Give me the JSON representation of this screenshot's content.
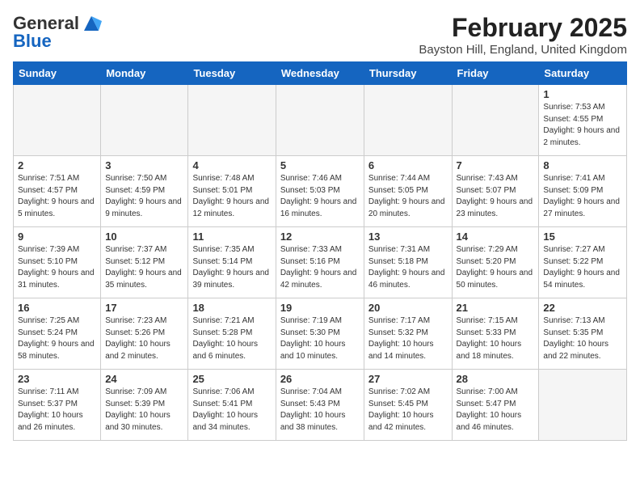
{
  "header": {
    "logo_text_general": "General",
    "logo_text_blue": "Blue",
    "month_title": "February 2025",
    "location": "Bayston Hill, England, United Kingdom"
  },
  "days_of_week": [
    "Sunday",
    "Monday",
    "Tuesday",
    "Wednesday",
    "Thursday",
    "Friday",
    "Saturday"
  ],
  "weeks": [
    [
      {
        "day": "",
        "info": ""
      },
      {
        "day": "",
        "info": ""
      },
      {
        "day": "",
        "info": ""
      },
      {
        "day": "",
        "info": ""
      },
      {
        "day": "",
        "info": ""
      },
      {
        "day": "",
        "info": ""
      },
      {
        "day": "1",
        "info": "Sunrise: 7:53 AM\nSunset: 4:55 PM\nDaylight: 9 hours and 2 minutes."
      }
    ],
    [
      {
        "day": "2",
        "info": "Sunrise: 7:51 AM\nSunset: 4:57 PM\nDaylight: 9 hours and 5 minutes."
      },
      {
        "day": "3",
        "info": "Sunrise: 7:50 AM\nSunset: 4:59 PM\nDaylight: 9 hours and 9 minutes."
      },
      {
        "day": "4",
        "info": "Sunrise: 7:48 AM\nSunset: 5:01 PM\nDaylight: 9 hours and 12 minutes."
      },
      {
        "day": "5",
        "info": "Sunrise: 7:46 AM\nSunset: 5:03 PM\nDaylight: 9 hours and 16 minutes."
      },
      {
        "day": "6",
        "info": "Sunrise: 7:44 AM\nSunset: 5:05 PM\nDaylight: 9 hours and 20 minutes."
      },
      {
        "day": "7",
        "info": "Sunrise: 7:43 AM\nSunset: 5:07 PM\nDaylight: 9 hours and 23 minutes."
      },
      {
        "day": "8",
        "info": "Sunrise: 7:41 AM\nSunset: 5:09 PM\nDaylight: 9 hours and 27 minutes."
      }
    ],
    [
      {
        "day": "9",
        "info": "Sunrise: 7:39 AM\nSunset: 5:10 PM\nDaylight: 9 hours and 31 minutes."
      },
      {
        "day": "10",
        "info": "Sunrise: 7:37 AM\nSunset: 5:12 PM\nDaylight: 9 hours and 35 minutes."
      },
      {
        "day": "11",
        "info": "Sunrise: 7:35 AM\nSunset: 5:14 PM\nDaylight: 9 hours and 39 minutes."
      },
      {
        "day": "12",
        "info": "Sunrise: 7:33 AM\nSunset: 5:16 PM\nDaylight: 9 hours and 42 minutes."
      },
      {
        "day": "13",
        "info": "Sunrise: 7:31 AM\nSunset: 5:18 PM\nDaylight: 9 hours and 46 minutes."
      },
      {
        "day": "14",
        "info": "Sunrise: 7:29 AM\nSunset: 5:20 PM\nDaylight: 9 hours and 50 minutes."
      },
      {
        "day": "15",
        "info": "Sunrise: 7:27 AM\nSunset: 5:22 PM\nDaylight: 9 hours and 54 minutes."
      }
    ],
    [
      {
        "day": "16",
        "info": "Sunrise: 7:25 AM\nSunset: 5:24 PM\nDaylight: 9 hours and 58 minutes."
      },
      {
        "day": "17",
        "info": "Sunrise: 7:23 AM\nSunset: 5:26 PM\nDaylight: 10 hours and 2 minutes."
      },
      {
        "day": "18",
        "info": "Sunrise: 7:21 AM\nSunset: 5:28 PM\nDaylight: 10 hours and 6 minutes."
      },
      {
        "day": "19",
        "info": "Sunrise: 7:19 AM\nSunset: 5:30 PM\nDaylight: 10 hours and 10 minutes."
      },
      {
        "day": "20",
        "info": "Sunrise: 7:17 AM\nSunset: 5:32 PM\nDaylight: 10 hours and 14 minutes."
      },
      {
        "day": "21",
        "info": "Sunrise: 7:15 AM\nSunset: 5:33 PM\nDaylight: 10 hours and 18 minutes."
      },
      {
        "day": "22",
        "info": "Sunrise: 7:13 AM\nSunset: 5:35 PM\nDaylight: 10 hours and 22 minutes."
      }
    ],
    [
      {
        "day": "23",
        "info": "Sunrise: 7:11 AM\nSunset: 5:37 PM\nDaylight: 10 hours and 26 minutes."
      },
      {
        "day": "24",
        "info": "Sunrise: 7:09 AM\nSunset: 5:39 PM\nDaylight: 10 hours and 30 minutes."
      },
      {
        "day": "25",
        "info": "Sunrise: 7:06 AM\nSunset: 5:41 PM\nDaylight: 10 hours and 34 minutes."
      },
      {
        "day": "26",
        "info": "Sunrise: 7:04 AM\nSunset: 5:43 PM\nDaylight: 10 hours and 38 minutes."
      },
      {
        "day": "27",
        "info": "Sunrise: 7:02 AM\nSunset: 5:45 PM\nDaylight: 10 hours and 42 minutes."
      },
      {
        "day": "28",
        "info": "Sunrise: 7:00 AM\nSunset: 5:47 PM\nDaylight: 10 hours and 46 minutes."
      },
      {
        "day": "",
        "info": ""
      }
    ]
  ]
}
